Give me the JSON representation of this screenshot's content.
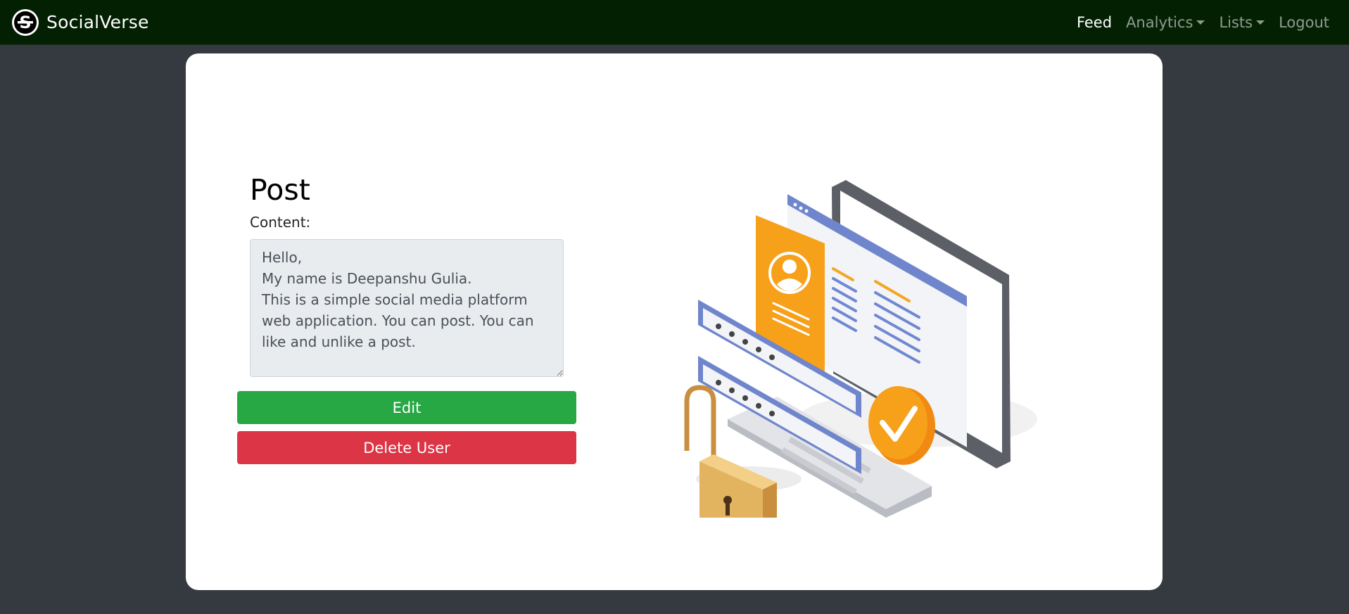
{
  "navbar": {
    "brand": "SocialVerse",
    "links": [
      {
        "label": "Feed"
      },
      {
        "label": "Analytics"
      },
      {
        "label": "Lists"
      },
      {
        "label": "Logout"
      }
    ]
  },
  "form": {
    "title": "Post",
    "content_label": "Content:",
    "content_value": "Hello,\nMy name is Deepanshu Gulia.\nThis is a simple social media platform web application. You can post. You can like and unlike a post.",
    "edit_label": "Edit",
    "delete_label": "Delete User"
  },
  "colors": {
    "navbar_bg": "#032003",
    "page_bg": "#343a40",
    "edit_green": "#28a745",
    "delete_red": "#dc3545"
  },
  "illustration": {
    "icon": "security-login-illustration"
  }
}
